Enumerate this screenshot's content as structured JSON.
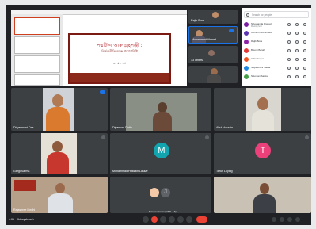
{
  "meeting": {
    "time_label": "4:01",
    "meeting_code_label": "fbt-uqsb-kwh"
  },
  "presentation": {
    "title_main": "পদ্মটিকা আৰু গ্ৰন্থপঞ্জী :",
    "title_sub": "নিৰ্ভৰ নীতি আৰু প্ৰয়োগবিধি",
    "author": "ড০ মন্দ দাস"
  },
  "side_tiles": [
    {
      "name": "Rajib Bora"
    },
    {
      "name": "Mohammed Ahmed"
    },
    {
      "name": "13 others"
    },
    {
      "name": ""
    }
  ],
  "people_panel": {
    "search_placeholder": "Search for people",
    "participants": [
      {
        "name": "Nityananda Prasad",
        "sub": "Meeting host",
        "color": "#7b1fa2"
      },
      {
        "name": "Mohammed Ahmed",
        "sub": "",
        "color": "#5e35b1"
      },
      {
        "name": "Rajib Bora",
        "sub": "",
        "color": "#8e24aa"
      },
      {
        "name": "Bhumi Borah",
        "sub": "",
        "color": "#e53935"
      },
      {
        "name": "Asha Gogoi",
        "sub": "",
        "color": "#f4511e"
      },
      {
        "name": "Nayanmoni Saikia",
        "sub": "",
        "color": "#1e88e5"
      },
      {
        "name": "Nitumoni Saikia",
        "sub": "",
        "color": "#43a047"
      }
    ]
  },
  "tiles": [
    {
      "name": "Dhyanmoni Das"
    },
    {
      "name": "Dipamoni Dutta"
    },
    {
      "name": "Abul Hussain"
    },
    {
      "name": "Gargi Sarma"
    },
    {
      "name": "Mohammad Hussain Laskar",
      "initial": "M",
      "color": "#12a4af"
    },
    {
      "name": "Tarun Loying",
      "initial": "T",
      "color": "#ec407a"
    },
    {
      "name": "Rajashree Medhi"
    },
    {
      "name": "",
      "initial": "J",
      "color": "#5f6368"
    },
    {
      "name": ""
    }
  ],
  "toolbar": {
    "tooltip": "Turn on camera (CTRL + E)"
  },
  "colors": {
    "background": "#202124",
    "tile": "#3c4043",
    "end_call": "#ea4335",
    "accent": "#1a73e8"
  }
}
